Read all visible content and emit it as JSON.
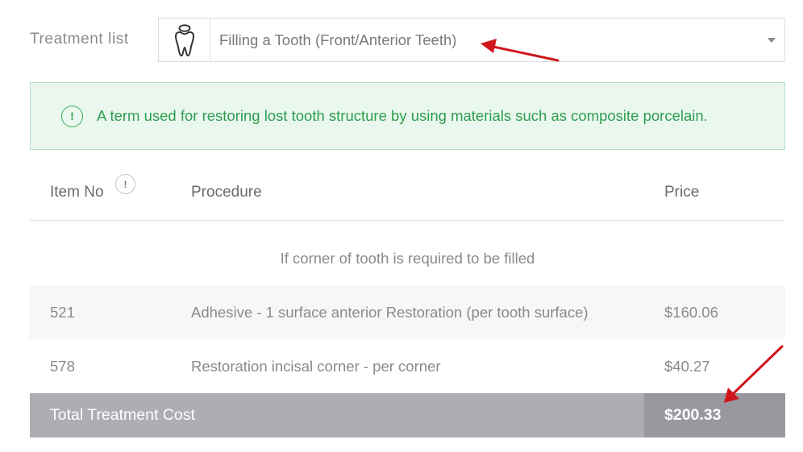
{
  "treatment": {
    "label": "Treatment list",
    "selected": "Filling a Tooth (Front/Anterior Teeth)",
    "icon": "tooth-icon"
  },
  "info": {
    "icon": "exclamation-icon",
    "symbol": "!",
    "text": "A term used for restoring lost tooth structure by using materials such as composite porcelain."
  },
  "table": {
    "headers": {
      "item_no": "Item No",
      "procedure": "Procedure",
      "price": "Price"
    },
    "hint_symbol": "!",
    "section_caption": "If corner of tooth is required to be filled",
    "rows": [
      {
        "item_no": "521",
        "procedure": "Adhesive - 1 surface anterior Restoration (per tooth surface)",
        "price": "$160.06"
      },
      {
        "item_no": "578",
        "procedure": "Restoration incisal corner - per corner",
        "price": "$40.27"
      }
    ],
    "total": {
      "label": "Total Treatment Cost",
      "price": "$200.33"
    }
  },
  "colors": {
    "info_text": "#2e9e4f",
    "info_bg": "#eaf7ee",
    "total_bg": "#adadb2",
    "total_price_bg": "#98989e",
    "annotation_arrow": "#d0161c"
  }
}
